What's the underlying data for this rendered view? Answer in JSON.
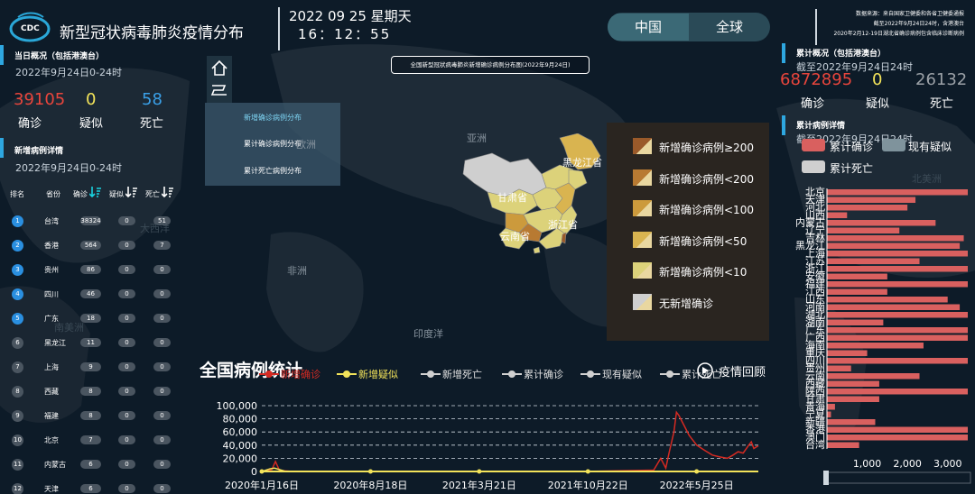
{
  "header": {
    "title": "新型冠状病毒肺炎疫情分布",
    "logo_text": "CDC",
    "date": "2022 09 25 星期天",
    "time": "16：12：55",
    "tabs": [
      {
        "label": "中国",
        "active": true
      },
      {
        "label": "全球",
        "active": false
      }
    ],
    "source_lines": [
      "数据来源：来自国家卫健委和各省卫健委通报",
      "截至2022年9月24日24时，含港澳台",
      "2020年2月12-19日湖北省确诊病例包含临床诊断病例"
    ]
  },
  "left": {
    "today": {
      "title": "当日概况（包括港澳台）",
      "date": "2022年9月24日0-24时",
      "stats": [
        {
          "value": "39105",
          "label": "确诊",
          "color": "#e8453c"
        },
        {
          "value": "0",
          "label": "疑似",
          "color": "#f2e35a"
        },
        {
          "value": "58",
          "label": "死亡",
          "color": "#3aa0e8"
        }
      ]
    },
    "detail": {
      "title": "新增病例详情",
      "date": "2022年9月24日0-24时",
      "columns": [
        "排名",
        "省份",
        "确诊",
        "疑似",
        "死亡"
      ],
      "rows": [
        {
          "rank": "1",
          "province": "台湾",
          "confirmed": "38324",
          "suspected": "0",
          "death": "51"
        },
        {
          "rank": "2",
          "province": "香港",
          "confirmed": "564",
          "suspected": "0",
          "death": "7"
        },
        {
          "rank": "3",
          "province": "贵州",
          "confirmed": "86",
          "suspected": "0",
          "death": "0"
        },
        {
          "rank": "4",
          "province": "四川",
          "confirmed": "46",
          "suspected": "0",
          "death": "0"
        },
        {
          "rank": "5",
          "province": "广东",
          "confirmed": "18",
          "suspected": "0",
          "death": "0"
        },
        {
          "rank": "6",
          "province": "黑龙江",
          "confirmed": "11",
          "suspected": "0",
          "death": "0"
        },
        {
          "rank": "7",
          "province": "上海",
          "confirmed": "9",
          "suspected": "0",
          "death": "0"
        },
        {
          "rank": "8",
          "province": "西藏",
          "confirmed": "8",
          "suspected": "0",
          "death": "0"
        },
        {
          "rank": "9",
          "province": "福建",
          "confirmed": "8",
          "suspected": "0",
          "death": "0"
        },
        {
          "rank": "10",
          "province": "北京",
          "confirmed": "7",
          "suspected": "0",
          "death": "0"
        },
        {
          "rank": "11",
          "province": "内蒙古",
          "confirmed": "6",
          "suspected": "0",
          "death": "0"
        },
        {
          "rank": "12",
          "province": "天津",
          "confirmed": "6",
          "suspected": "0",
          "death": "0"
        }
      ]
    }
  },
  "map": {
    "title": "全国新型冠状病毒肺炎新增确诊病例分布图(2022年9月24日)",
    "menu": [
      "新增确诊病例分布",
      "累计确诊病例分布",
      "累计死亡病例分布"
    ],
    "menu_active": 0,
    "continents": [
      "亚洲",
      "欧洲",
      "非洲",
      "印度洋",
      "南美洲",
      "大西洋"
    ],
    "province_labels": [
      "黑龙江省",
      "甘肃省",
      "浙江省",
      "云南省"
    ],
    "legend": [
      {
        "label": "新增确诊病例≥200",
        "color": "#9a5a2a"
      },
      {
        "label": "新增确诊病例<200",
        "color": "#b87a32"
      },
      {
        "label": "新增确诊病例<100",
        "color": "#cc9a3c"
      },
      {
        "label": "新增确诊病例<50",
        "color": "#d9b450"
      },
      {
        "label": "新增确诊病例<10",
        "color": "#dcd27a"
      },
      {
        "label": "无新增确诊",
        "color": "#cfcfcf"
      }
    ]
  },
  "right": {
    "cum": {
      "title": "累计概况（包括港澳台）",
      "date": "截至2022年9月24日24时",
      "stats": [
        {
          "value": "6872895",
          "label": "确诊",
          "color": "#e8453c"
        },
        {
          "value": "0",
          "label": "疑似",
          "color": "#f2e35a"
        },
        {
          "value": "26132",
          "label": "死亡",
          "color": "#9aa0a6"
        }
      ]
    },
    "detail": {
      "title": "累计病例详情",
      "date": "截至2022年9月24日24时",
      "legend": [
        {
          "label": "累计确诊",
          "color": "#d9605f"
        },
        {
          "label": "现有疑似",
          "color": "#7f939c"
        },
        {
          "label": "累计死亡",
          "color": "#cfcfcf"
        }
      ],
      "watermark": "北美洲"
    }
  },
  "trend": {
    "title": "全国病例统计",
    "legend": [
      {
        "label": "新增确诊",
        "color": "#d42a22"
      },
      {
        "label": "新增疑似",
        "color": "#f2e35a"
      },
      {
        "label": "新增死亡",
        "color": "#d0d0d0"
      },
      {
        "label": "累计确诊",
        "color": "#d0d0d0"
      },
      {
        "label": "现有疑似",
        "color": "#d0d0d0"
      },
      {
        "label": "累计死亡",
        "color": "#d0d0d0"
      }
    ],
    "replay": "疫情回顾"
  },
  "chart_data": [
    {
      "type": "line",
      "x_tick_labels": [
        "2020年1月16日",
        "2020年8月18日",
        "2021年3月21日",
        "2021年10月22日",
        "2022年5月25日"
      ],
      "y_tick_labels": [
        "0",
        "20,000",
        "40,000",
        "60,000",
        "80,000",
        "100,000"
      ],
      "ylim": [
        0,
        100000
      ],
      "x_range": [
        "2020-01-16",
        "2022-09-24"
      ],
      "series": [
        {
          "name": "新增确诊",
          "color": "#d42a22",
          "x": [
            "2020-01-16",
            "2020-02-05",
            "2020-02-12",
            "2020-02-20",
            "2020-03-15",
            "2021-10-22",
            "2022-03-01",
            "2022-03-15",
            "2022-03-25",
            "2022-04-01",
            "2022-04-10",
            "2022-04-15",
            "2022-04-20",
            "2022-04-30",
            "2022-05-10",
            "2022-05-25",
            "2022-06-10",
            "2022-06-25",
            "2022-07-10",
            "2022-07-25",
            "2022-08-05",
            "2022-08-15",
            "2022-08-25",
            "2022-09-05",
            "2022-09-10",
            "2022-09-15",
            "2022-09-24"
          ],
          "y": [
            0,
            3000,
            15000,
            1500,
            200,
            100,
            2000,
            20000,
            5000,
            30000,
            60000,
            90000,
            85000,
            70000,
            55000,
            40000,
            32000,
            25000,
            22000,
            20000,
            25000,
            30000,
            28000,
            40000,
            45000,
            35000,
            39105
          ]
        },
        {
          "name": "新增疑似",
          "color": "#f2e35a",
          "x": [
            "2020-01-16",
            "2020-02-01",
            "2020-02-10",
            "2020-03-01",
            "2020-04-01",
            "2022-09-24"
          ],
          "y": [
            0,
            4000,
            5000,
            500,
            0,
            0
          ]
        }
      ]
    },
    {
      "type": "bar",
      "categories": [
        "北京",
        "天津",
        "河北",
        "山西",
        "内蒙古",
        "辽宁",
        "吉林",
        "黑龙江",
        "上海",
        "江苏",
        "浙江",
        "安徽",
        "福建",
        "江西",
        "山东",
        "河南",
        "湖北",
        "湖南",
        "广东",
        "广西",
        "海南",
        "重庆",
        "四川",
        "贵州",
        "云南",
        "西藏",
        "陕西",
        "甘肃",
        "青海",
        "宁夏",
        "新疆",
        "香港",
        "澳门",
        "台湾"
      ],
      "values": [
        3500,
        2200,
        2000,
        500,
        2700,
        1800,
        3400,
        3300,
        3500,
        2300,
        3500,
        1500,
        3500,
        1500,
        3000,
        3300,
        3500,
        1400,
        3500,
        3500,
        2400,
        1000,
        3500,
        600,
        2300,
        1300,
        3500,
        1300,
        200,
        100,
        1200,
        3500,
        3500,
        800
      ],
      "xlim": [
        0,
        3500
      ],
      "x_tick_labels": [
        "1,000",
        "2,000",
        "3,000"
      ]
    }
  ]
}
